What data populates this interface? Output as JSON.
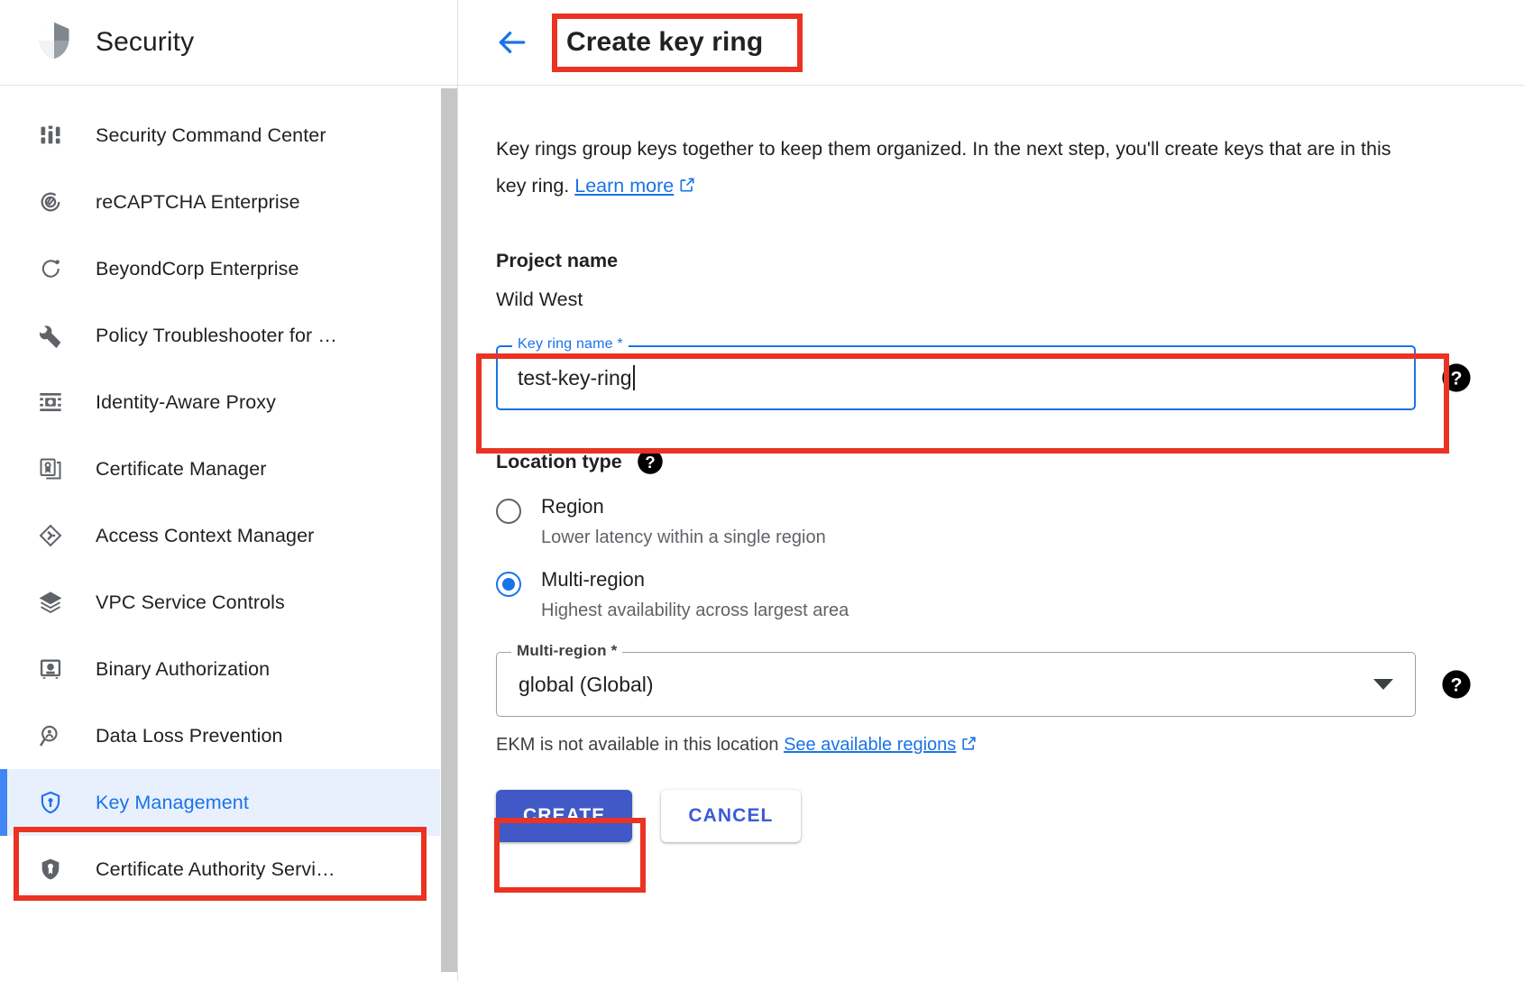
{
  "sidebar": {
    "title": "Security",
    "logo_icon": "shield-icon",
    "items": [
      {
        "label": "Security Command Center",
        "icon": "dashboard-icon",
        "selected": false
      },
      {
        "label": "reCAPTCHA Enterprise",
        "icon": "recaptcha-icon",
        "selected": false
      },
      {
        "label": "BeyondCorp Enterprise",
        "icon": "beyondcorp-icon",
        "selected": false
      },
      {
        "label": "Policy Troubleshooter for …",
        "icon": "wrench-icon",
        "selected": false
      },
      {
        "label": "Identity-Aware Proxy",
        "icon": "proxy-icon",
        "selected": false
      },
      {
        "label": "Certificate Manager",
        "icon": "certificate-icon",
        "selected": false
      },
      {
        "label": "Access Context Manager",
        "icon": "diamond-icon",
        "selected": false
      },
      {
        "label": "VPC Service Controls",
        "icon": "layers-icon",
        "selected": false
      },
      {
        "label": "Binary Authorization",
        "icon": "binary-auth-icon",
        "selected": false
      },
      {
        "label": "Data Loss Prevention",
        "icon": "magnify-person-icon",
        "selected": false
      },
      {
        "label": "Key Management",
        "icon": "key-shield-icon",
        "selected": true
      },
      {
        "label": "Certificate Authority Servi…",
        "icon": "ca-shield-icon",
        "selected": false
      }
    ]
  },
  "header": {
    "back_icon": "back-arrow-icon",
    "title": "Create key ring"
  },
  "main": {
    "intro_text_1": "Key rings group keys together to keep them organized. In the next step, you'll create keys that are in this key ring.",
    "learn_more_label": "Learn more",
    "project_name_label": "Project name",
    "project_name_value": "Wild West",
    "key_ring_name_label": "Key ring name *",
    "key_ring_name_value": "test-key-ring",
    "key_ring_name_help_icon": "help-icon",
    "location_type_label": "Location type",
    "location_type_help_icon": "help-icon",
    "options": [
      {
        "label": "Region",
        "sublabel": "Lower latency within a single region",
        "selected": false
      },
      {
        "label": "Multi-region",
        "sublabel": "Highest availability across largest area",
        "selected": true
      }
    ],
    "multi_region_label": "Multi-region *",
    "multi_region_value": "global (Global)",
    "multi_region_help_icon": "help-icon",
    "dropdown_icon": "chevron-down-icon",
    "ekm_hint": "EKM is not available in this location",
    "see_regions_label": "See available regions",
    "create_label": "CREATE",
    "cancel_label": "CANCEL"
  },
  "colors": {
    "accent_blue": "#1a73e8",
    "selected_bg": "#e8f0fe",
    "annotation_red": "#ea3323",
    "create_button": "#4059c6",
    "muted_text": "#5f6368"
  }
}
